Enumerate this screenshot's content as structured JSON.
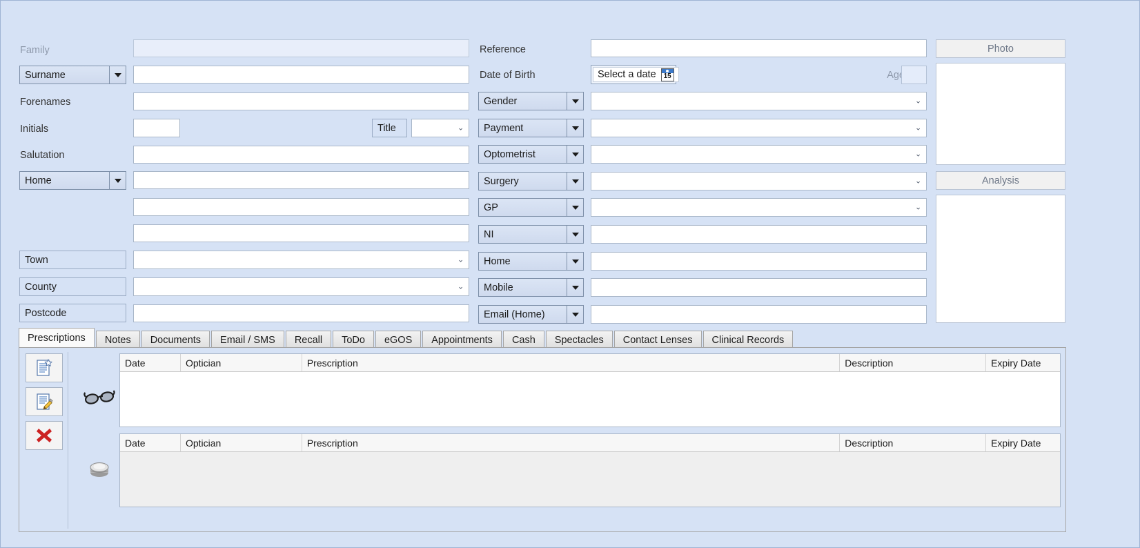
{
  "form": {
    "left": {
      "family_label": "Family",
      "family_value": "",
      "surname_dropdown": "Surname",
      "surname_value": "",
      "forenames_label": "Forenames",
      "forenames_value": "",
      "initials_label": "Initials",
      "initials_value": "",
      "title_label": "Title",
      "title_value": "",
      "salutation_label": "Salutation",
      "salutation_value": "",
      "address_type_dropdown": "Home",
      "address_line1": "",
      "address_line2": "",
      "address_line3": "",
      "town_label": "Town",
      "town_value": "",
      "county_label": "County",
      "county_value": "",
      "postcode_label": "Postcode",
      "postcode_value": ""
    },
    "middle": {
      "reference_label": "Reference",
      "reference_value": "",
      "dob_label": "Date of Birth",
      "dob_button": "Select a date",
      "dob_calendar_day": "15",
      "age_label": "Age",
      "age_value": "",
      "rows": [
        {
          "dropdown": "Gender",
          "value": "",
          "kind": "combo"
        },
        {
          "dropdown": "Payment",
          "value": "",
          "kind": "combo"
        },
        {
          "dropdown": "Optometrist",
          "value": "",
          "kind": "combo"
        },
        {
          "dropdown": "Surgery",
          "value": "",
          "kind": "combo"
        },
        {
          "dropdown": "GP",
          "value": "",
          "kind": "combo"
        },
        {
          "dropdown": "NI",
          "value": "",
          "kind": "text"
        },
        {
          "dropdown": "Home",
          "value": "",
          "kind": "text"
        },
        {
          "dropdown": "Mobile",
          "value": "",
          "kind": "text"
        },
        {
          "dropdown": "Email (Home)",
          "value": "",
          "kind": "text"
        }
      ]
    },
    "right": {
      "photo_header": "Photo",
      "analysis_header": "Analysis"
    }
  },
  "tabs": [
    {
      "label": "Prescriptions",
      "active": true
    },
    {
      "label": "Notes",
      "active": false
    },
    {
      "label": "Documents",
      "active": false
    },
    {
      "label": "Email / SMS",
      "active": false
    },
    {
      "label": "Recall",
      "active": false
    },
    {
      "label": "ToDo",
      "active": false
    },
    {
      "label": "eGOS",
      "active": false
    },
    {
      "label": "Appointments",
      "active": false
    },
    {
      "label": "Cash",
      "active": false
    },
    {
      "label": "Spectacles",
      "active": false
    },
    {
      "label": "Contact Lenses",
      "active": false
    },
    {
      "label": "Clinical Records",
      "active": false
    }
  ],
  "toolbar": {
    "new_label": "New prescription",
    "edit_label": "Edit prescription",
    "delete_label": "Delete prescription"
  },
  "grids": {
    "spectacles": {
      "columns": [
        "Date",
        "Optician",
        "Prescription",
        "Description",
        "Expiry Date"
      ],
      "rows": []
    },
    "contact_lenses": {
      "columns": [
        "Date",
        "Optician",
        "Prescription",
        "Description",
        "Expiry Date"
      ],
      "rows": []
    }
  },
  "colors": {
    "window_bg": "#d6e2f5",
    "field_bg": "#ffffff",
    "accent": "#3c79c8",
    "delete_red": "#cc2222"
  }
}
